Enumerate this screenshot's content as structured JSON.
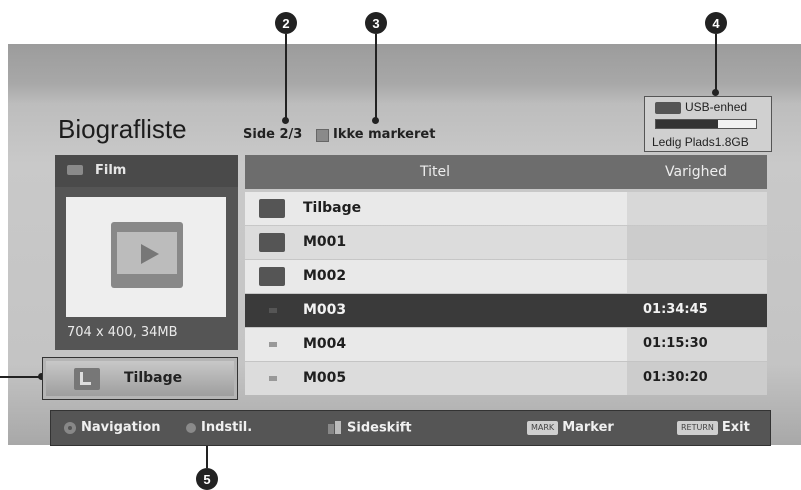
{
  "callouts": [
    "2",
    "3",
    "4",
    "5"
  ],
  "header": {
    "title": "Biografliste",
    "page_info": "Side 2/3",
    "mark_status": "Ikke markeret"
  },
  "usb": {
    "device_label": "USB-enhed",
    "free_space": "Ledig Plads1.8GB",
    "used_fraction": 0.62
  },
  "left_panel": {
    "category": "Film",
    "resolution_size": "704 x 400, 34MB",
    "back_label": "Tilbage"
  },
  "table": {
    "columns": [
      "Titel",
      "Varighed"
    ],
    "rows": [
      {
        "name": "Tilbage",
        "duration": "",
        "kind": "back"
      },
      {
        "name": "M001",
        "duration": "",
        "kind": "folder"
      },
      {
        "name": "M002",
        "duration": "",
        "kind": "folder"
      },
      {
        "name": "M003",
        "duration": "01:34:45",
        "kind": "file",
        "selected": true
      },
      {
        "name": "M004",
        "duration": "01:15:30",
        "kind": "file"
      },
      {
        "name": "M005",
        "duration": "01:30:20",
        "kind": "file"
      }
    ]
  },
  "navbar": {
    "navigation": "Navigation",
    "settings": "Indstil.",
    "page_change": "Sideskift",
    "mark_key": "MARK",
    "mark": "Marker",
    "return_key": "RETURN",
    "exit": "Exit"
  },
  "colors": {
    "selected_row": "#3a3a3a",
    "light_row": "#e6e6e6",
    "header_row": "#6d6d6d"
  }
}
